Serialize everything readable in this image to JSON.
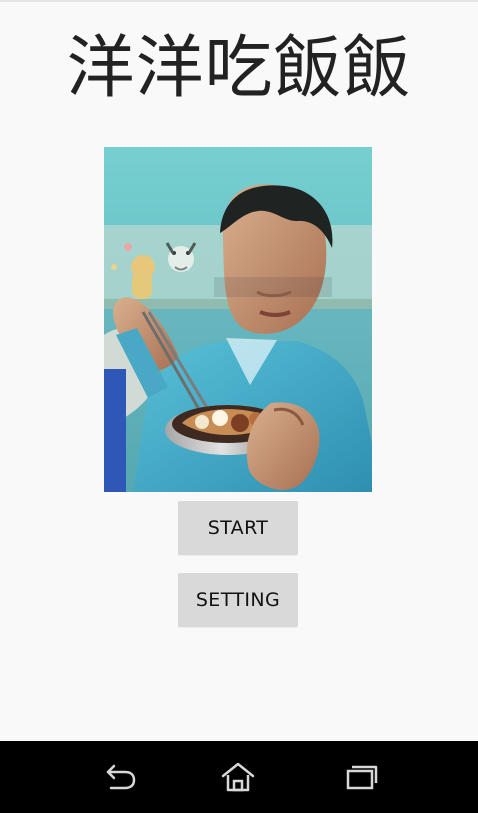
{
  "app": {
    "title": "洋洋吃飯飯"
  },
  "photo": {
    "description_icon": "photo-image",
    "content": "Person holding chopsticks and a bowl of rice"
  },
  "buttons": {
    "start_label": "START",
    "setting_label": "SETTING"
  },
  "navigation": {
    "back_icon": "back-icon",
    "home_icon": "home-icon",
    "recents_icon": "recents-icon"
  },
  "colors": {
    "app_background": "#f9f9fa",
    "button_background": "#d9d9d9",
    "navbar_background": "#000000"
  }
}
